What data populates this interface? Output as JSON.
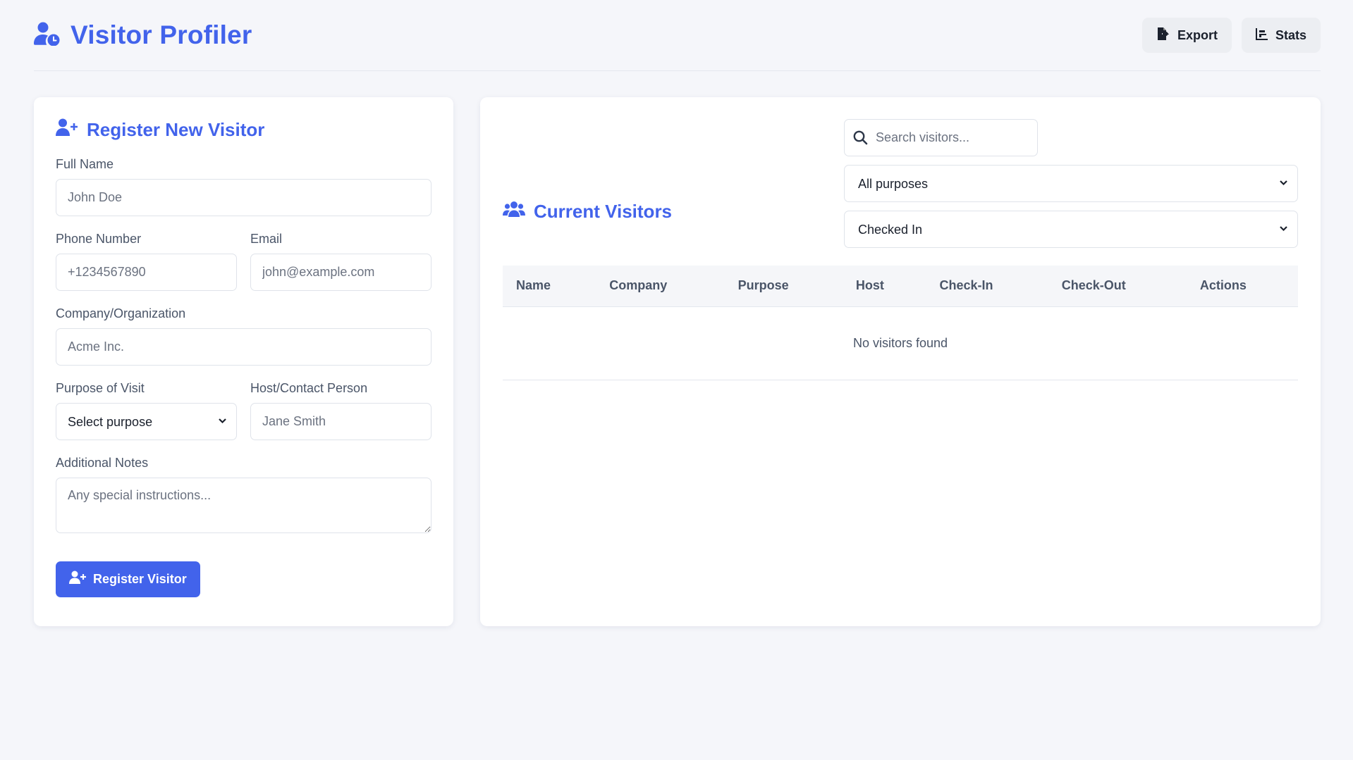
{
  "app": {
    "title": "Visitor Profiler",
    "accent_color": "#4263eb",
    "logo_icon": "user-clock-icon"
  },
  "header": {
    "export_label": "Export",
    "export_icon": "file-export-icon",
    "stats_label": "Stats",
    "stats_icon": "chart-bar-icon"
  },
  "register": {
    "title": "Register New Visitor",
    "title_icon": "user-plus-icon",
    "full_name": {
      "label": "Full Name",
      "placeholder": "John Doe"
    },
    "phone": {
      "label": "Phone Number",
      "placeholder": "+1234567890"
    },
    "email": {
      "label": "Email",
      "placeholder": "john@example.com"
    },
    "company": {
      "label": "Company/Organization",
      "placeholder": "Acme Inc."
    },
    "purpose": {
      "label": "Purpose of Visit",
      "selected": "Select purpose"
    },
    "host": {
      "label": "Host/Contact Person",
      "placeholder": "Jane Smith"
    },
    "notes": {
      "label": "Additional Notes",
      "placeholder": "Any special instructions..."
    },
    "submit_label": "Register Visitor",
    "submit_icon": "user-plus-icon"
  },
  "visitors": {
    "title": "Current Visitors",
    "title_icon": "users-icon",
    "search_placeholder": "Search visitors...",
    "purpose_filter": "All purposes",
    "status_filter": "Checked In",
    "columns": [
      "Name",
      "Company",
      "Purpose",
      "Host",
      "Check-In",
      "Check-Out",
      "Actions"
    ],
    "empty_text": "No visitors found"
  }
}
